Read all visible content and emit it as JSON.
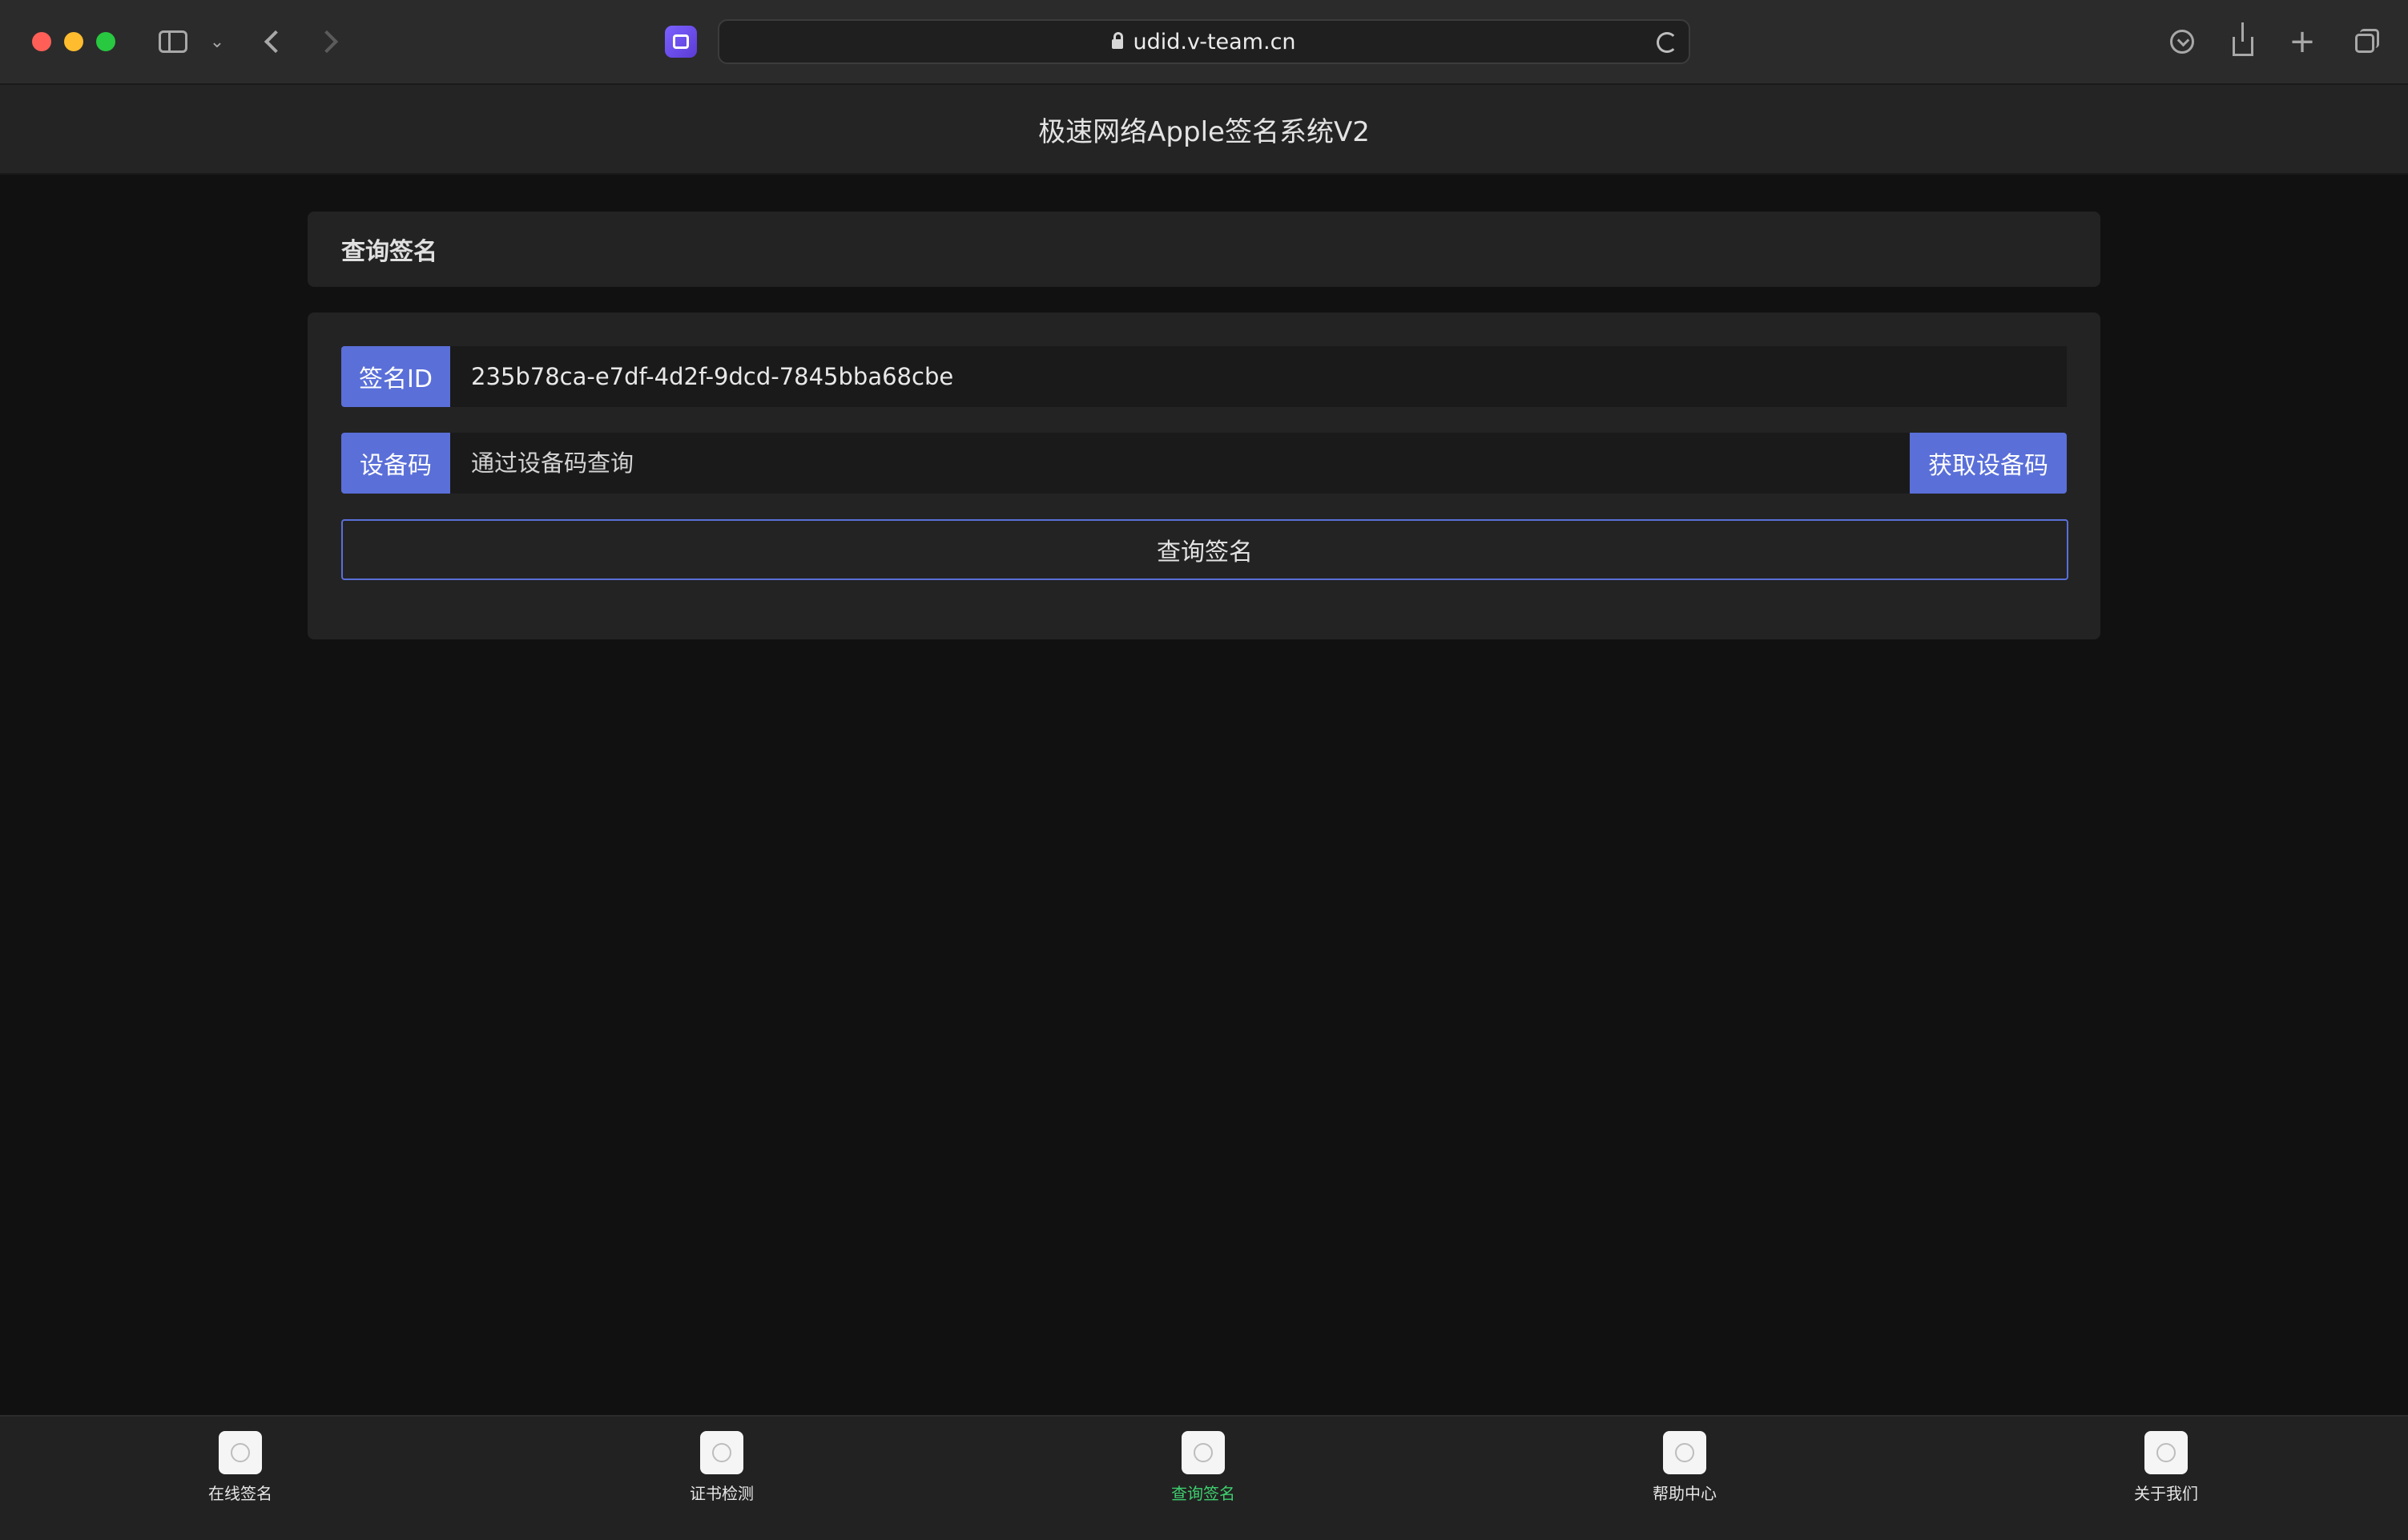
{
  "browser": {
    "url": "udid.v-team.cn",
    "icons": {
      "sidebar": "sidebar-icon",
      "sidebar_menu": "chevron-down-icon",
      "back": "chevron-left-icon",
      "forward": "chevron-right-icon",
      "extension": "extension-icon",
      "secure": "lock-icon",
      "reload": "reload-icon",
      "download": "download-icon",
      "share": "share-icon",
      "new_tab": "plus-icon",
      "tab_overview": "tabs-icon"
    }
  },
  "header": {
    "title": "极速网络Apple签名系统V2"
  },
  "panel_header": {
    "title": "查询签名"
  },
  "form": {
    "sign_id": {
      "label": "签名ID",
      "value": "235b78ca-e7df-4d2f-9dcd-7845bba68cbe"
    },
    "device_code": {
      "label": "设备码",
      "placeholder": "通过设备码查询",
      "value": "",
      "get_button": "获取设备码"
    },
    "submit_button": "查询签名"
  },
  "tabbar": {
    "items": [
      {
        "label": "在线签名",
        "active": false
      },
      {
        "label": "证书检测",
        "active": false
      },
      {
        "label": "查询签名",
        "active": true
      },
      {
        "label": "帮助中心",
        "active": false
      },
      {
        "label": "关于我们",
        "active": false
      }
    ]
  },
  "colors": {
    "accent": "#5a6fd8",
    "active_tab": "#3ecf6e",
    "background": "#111111"
  }
}
